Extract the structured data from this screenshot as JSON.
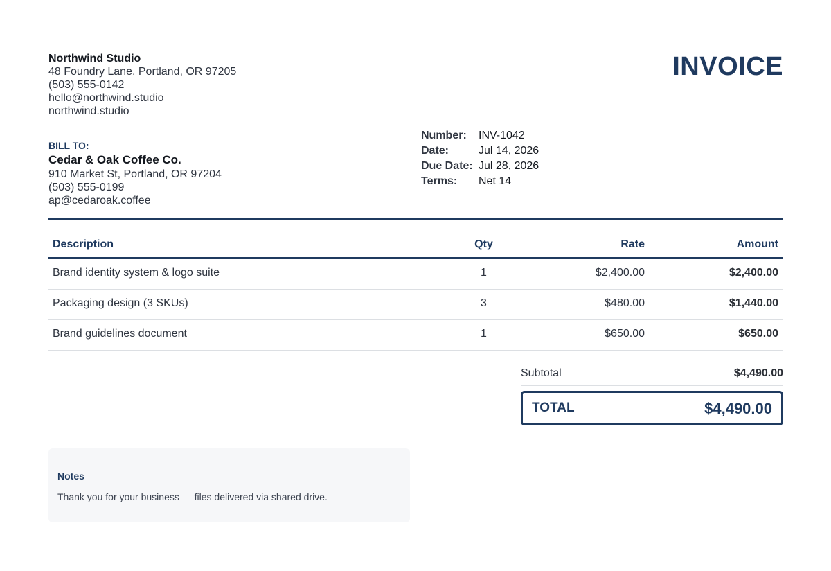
{
  "sender": {
    "name": "Northwind Studio",
    "address": "48 Foundry Lane, Portland, OR 97205",
    "phone": "(503) 555-0142",
    "email": "hello@northwind.studio",
    "website": "northwind.studio"
  },
  "document_title": "INVOICE",
  "bill_to": {
    "label": "BILL TO:",
    "client": "Cedar & Oak Coffee Co.",
    "address": "910 Market St, Portland, OR 97204",
    "phone": "(503) 555-0199",
    "email": "ap@cedaroak.coffee"
  },
  "meta": [
    {
      "label": "Number:",
      "value": "INV-1042"
    },
    {
      "label": "Date:",
      "value": "Jul 14, 2026"
    },
    {
      "label": "Due Date:",
      "value": "Jul 28, 2026"
    },
    {
      "label": "Terms:",
      "value": "Net 14"
    }
  ],
  "table": {
    "headers": {
      "description": "Description",
      "qty": "Qty",
      "rate": "Rate",
      "amount": "Amount"
    },
    "rows": [
      {
        "description": "Brand identity system & logo suite",
        "qty": "1",
        "rate": "$2,400.00",
        "amount": "$2,400.00"
      },
      {
        "description": "Packaging design (3 SKUs)",
        "qty": "3",
        "rate": "$480.00",
        "amount": "$1,440.00"
      },
      {
        "description": "Brand guidelines document",
        "qty": "1",
        "rate": "$650.00",
        "amount": "$650.00"
      }
    ]
  },
  "totals": {
    "subtotal_label": "Subtotal",
    "subtotal_value": "$4,490.00",
    "total_label": "TOTAL",
    "total_value": "$4,490.00"
  },
  "notes": {
    "title": "Notes",
    "body": "Thank you for your business — files delivered via shared drive."
  },
  "colors": {
    "accent": "#1f3a5f",
    "divider": "#dcdfe3",
    "notes_background": "#f6f7f9"
  }
}
